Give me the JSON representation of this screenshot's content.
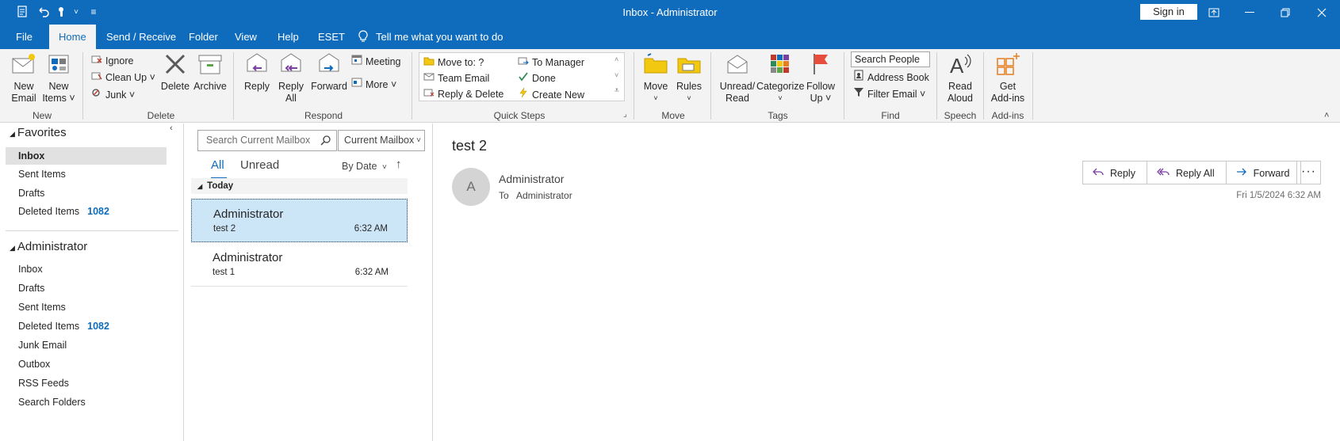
{
  "window": {
    "title": "Inbox - Administrator",
    "sign_in": "Sign in"
  },
  "menu": {
    "tabs": [
      "File",
      "Home",
      "Send / Receive",
      "Folder",
      "View",
      "Help",
      "ESET"
    ],
    "active_tab": "Home",
    "tell_me": "Tell me what you want to do"
  },
  "ribbon": {
    "new": {
      "new_email": [
        "New",
        "Email"
      ],
      "new_items": [
        "New",
        "Items ˅"
      ],
      "group": "New"
    },
    "delete": {
      "ignore": "Ignore",
      "clean_up": "Clean Up ˅",
      "junk": "Junk ˅",
      "delete": "Delete",
      "archive": "Archive",
      "group": "Delete"
    },
    "respond": {
      "reply": "Reply",
      "reply_all": [
        "Reply",
        "All"
      ],
      "forward": "Forward",
      "meeting": "Meeting",
      "more": "More ˅",
      "group": "Respond"
    },
    "quick_steps": {
      "items": [
        "Move to: ?",
        "To Manager",
        "Team Email",
        "Done",
        "Reply & Delete",
        "Create New"
      ],
      "group": "Quick Steps"
    },
    "move": {
      "move": "Move",
      "rules": "Rules",
      "group": "Move"
    },
    "tags": {
      "unread_read": [
        "Unread/",
        "Read"
      ],
      "categorize": "Categorize",
      "follow_up": [
        "Follow",
        "Up ˅"
      ],
      "group": "Tags"
    },
    "find": {
      "search_people": "Search People",
      "address_book": "Address Book",
      "filter_email": "Filter Email ˅",
      "group": "Find"
    },
    "speech": {
      "read_aloud": [
        "Read",
        "Aloud"
      ],
      "group": "Speech"
    },
    "addins": {
      "get_addins": [
        "Get",
        "Add-ins"
      ],
      "group": "Add-ins"
    }
  },
  "folders": {
    "favorites_label": "Favorites",
    "favorites": [
      {
        "label": "Inbox",
        "count": ""
      },
      {
        "label": "Sent Items",
        "count": ""
      },
      {
        "label": "Drafts",
        "count": ""
      },
      {
        "label": "Deleted Items",
        "count": "1082"
      }
    ],
    "account_label": "Administrator",
    "account": [
      {
        "label": "Inbox",
        "count": ""
      },
      {
        "label": "Drafts",
        "count": ""
      },
      {
        "label": "Sent Items",
        "count": ""
      },
      {
        "label": "Deleted Items",
        "count": "1082"
      },
      {
        "label": "Junk Email",
        "count": ""
      },
      {
        "label": "Outbox",
        "count": ""
      },
      {
        "label": "RSS Feeds",
        "count": ""
      },
      {
        "label": "Search Folders",
        "count": ""
      }
    ]
  },
  "list": {
    "search_placeholder": "Search Current Mailbox",
    "scope": "Current Mailbox",
    "filter_all": "All",
    "filter_unread": "Unread",
    "sort": "By Date",
    "group_header": "Today",
    "messages": [
      {
        "from": "Administrator",
        "subject": "test 2",
        "time": "6:32 AM"
      },
      {
        "from": "Administrator",
        "subject": "test 1",
        "time": "6:32 AM"
      }
    ]
  },
  "reading": {
    "subject": "test 2",
    "avatar_initial": "A",
    "from": "Administrator",
    "to_label": "To",
    "to": "Administrator",
    "reply": "Reply",
    "reply_all": "Reply All",
    "forward": "Forward",
    "more": "···",
    "date": "Fri 1/5/2024 6:32 AM"
  },
  "colors": {
    "accent": "#0f6cbd",
    "ribbon_bg": "#f3f3f3",
    "selected_row": "#cde6f7",
    "count_blue": "#0f6cbd"
  }
}
